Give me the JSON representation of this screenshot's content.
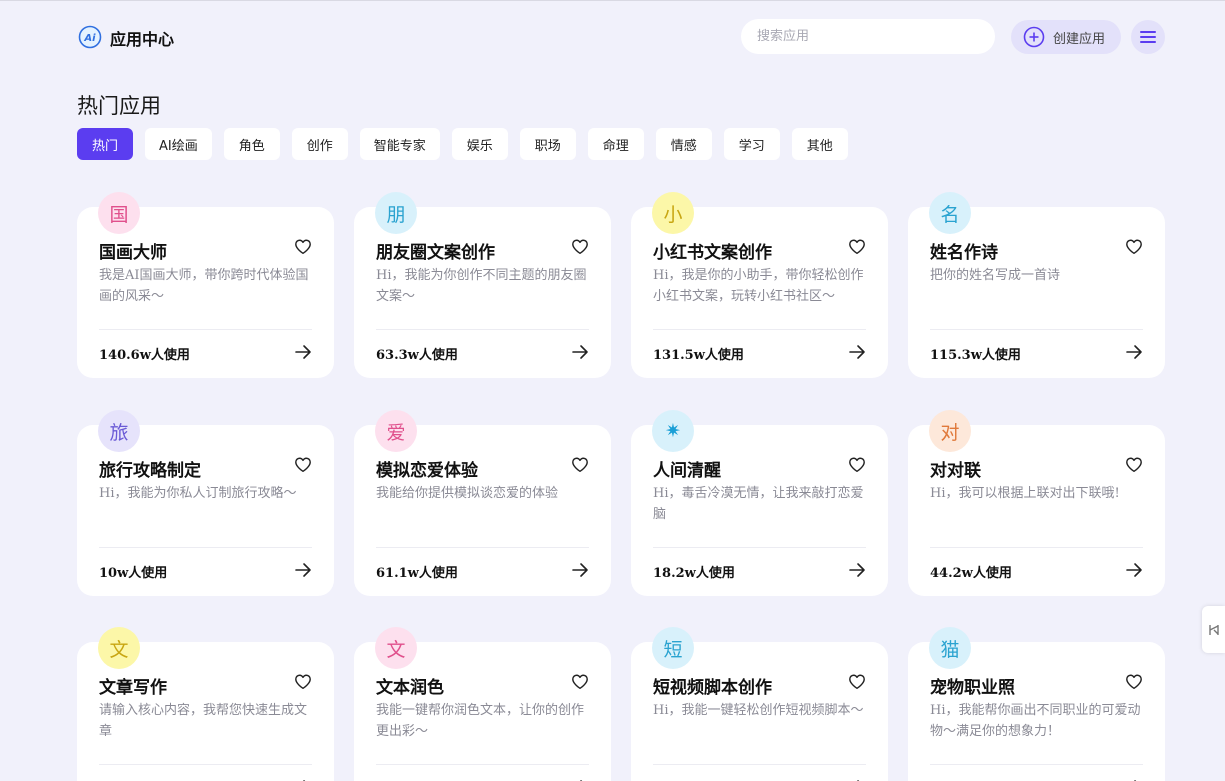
{
  "header": {
    "logo_text": "Ai",
    "title": "应用中心",
    "search_placeholder": "搜索应用",
    "create_label": "创建应用"
  },
  "section_title": "热门应用",
  "tabs": [
    "热门",
    "AI绘画",
    "角色",
    "创作",
    "智能专家",
    "娱乐",
    "职场",
    "命理",
    "情感",
    "学习",
    "其他"
  ],
  "active_tab": "热门",
  "cards": [
    {
      "icon_char": "国",
      "icon_bg": "#fde0ee",
      "icon_color": "#e0508c",
      "title": "国画大师",
      "desc": "我是AI国画大师，带你跨时代体验国画的风采～",
      "usage": "140.6w人使用"
    },
    {
      "icon_char": "朋",
      "icon_bg": "#d8f1fb",
      "icon_color": "#2aa3d0",
      "title": "朋友圈文案创作",
      "desc": "Hi，我能为你创作不同主题的朋友圈文案～",
      "usage": "63.3w人使用"
    },
    {
      "icon_char": "小",
      "icon_bg": "#fcf7a8",
      "icon_color": "#c8a612",
      "title": "小红书文案创作",
      "desc": "Hi，我是你的小助手，带你轻松创作小红书文案，玩转小红书社区～",
      "usage": "131.5w人使用"
    },
    {
      "icon_char": "名",
      "icon_bg": "#d8f1fb",
      "icon_color": "#2aa3d0",
      "title": "姓名作诗",
      "desc": "把你的姓名写成一首诗",
      "usage": "115.3w人使用"
    },
    {
      "icon_char": "旅",
      "icon_bg": "#e6e3fb",
      "icon_color": "#6a5ad6",
      "title": "旅行攻略制定",
      "desc": "Hi，我能为你私人订制旅行攻略～",
      "usage": "10w人使用"
    },
    {
      "icon_char": "爱",
      "icon_bg": "#fde0ee",
      "icon_color": "#e0508c",
      "title": "模拟恋爱体验",
      "desc": "我能给你提供模拟谈恋爱的体验",
      "usage": "61.1w人使用"
    },
    {
      "icon_char": "✷",
      "icon_bg": "#d8f1fb",
      "icon_color": "#1a9fd6",
      "title": "人间清醒",
      "desc": "Hi，毒舌冷漠无情，让我来敲打恋爱脑",
      "usage": "18.2w人使用"
    },
    {
      "icon_char": "对",
      "icon_bg": "#fde8da",
      "icon_color": "#e0793a",
      "title": "对对联",
      "desc": "Hi，我可以根据上联对出下联哦!",
      "usage": "44.2w人使用"
    },
    {
      "icon_char": "文",
      "icon_bg": "#fcf7a8",
      "icon_color": "#c8a612",
      "title": "文章写作",
      "desc": "请输入核心内容，我帮您快速生成文章",
      "usage": ""
    },
    {
      "icon_char": "文",
      "icon_bg": "#fde0ee",
      "icon_color": "#e0508c",
      "title": "文本润色",
      "desc": "我能一键帮你润色文本，让你的创作更出彩～",
      "usage": ""
    },
    {
      "icon_char": "短",
      "icon_bg": "#d8f1fb",
      "icon_color": "#2aa3d0",
      "title": "短视频脚本创作",
      "desc": "Hi，我能一键轻松创作短视频脚本～",
      "usage": ""
    },
    {
      "icon_char": "猫",
      "icon_bg": "#d8f1fb",
      "icon_color": "#2aa3d0",
      "title": "宠物职业照",
      "desc": "Hi，我能帮你画出不同职业的可爱动物～满足你的想象力！",
      "usage": ""
    }
  ],
  "colors": {
    "accent": "#5b3df0",
    "page_bg": "#f1f1fb",
    "create_btn_bg": "#e3e1fa"
  },
  "icons": [
    "ai-logo-icon",
    "plus-circle-icon",
    "hamburger-menu-icon",
    "heart-icon",
    "arrow-right-icon",
    "side-panel-icon"
  ]
}
